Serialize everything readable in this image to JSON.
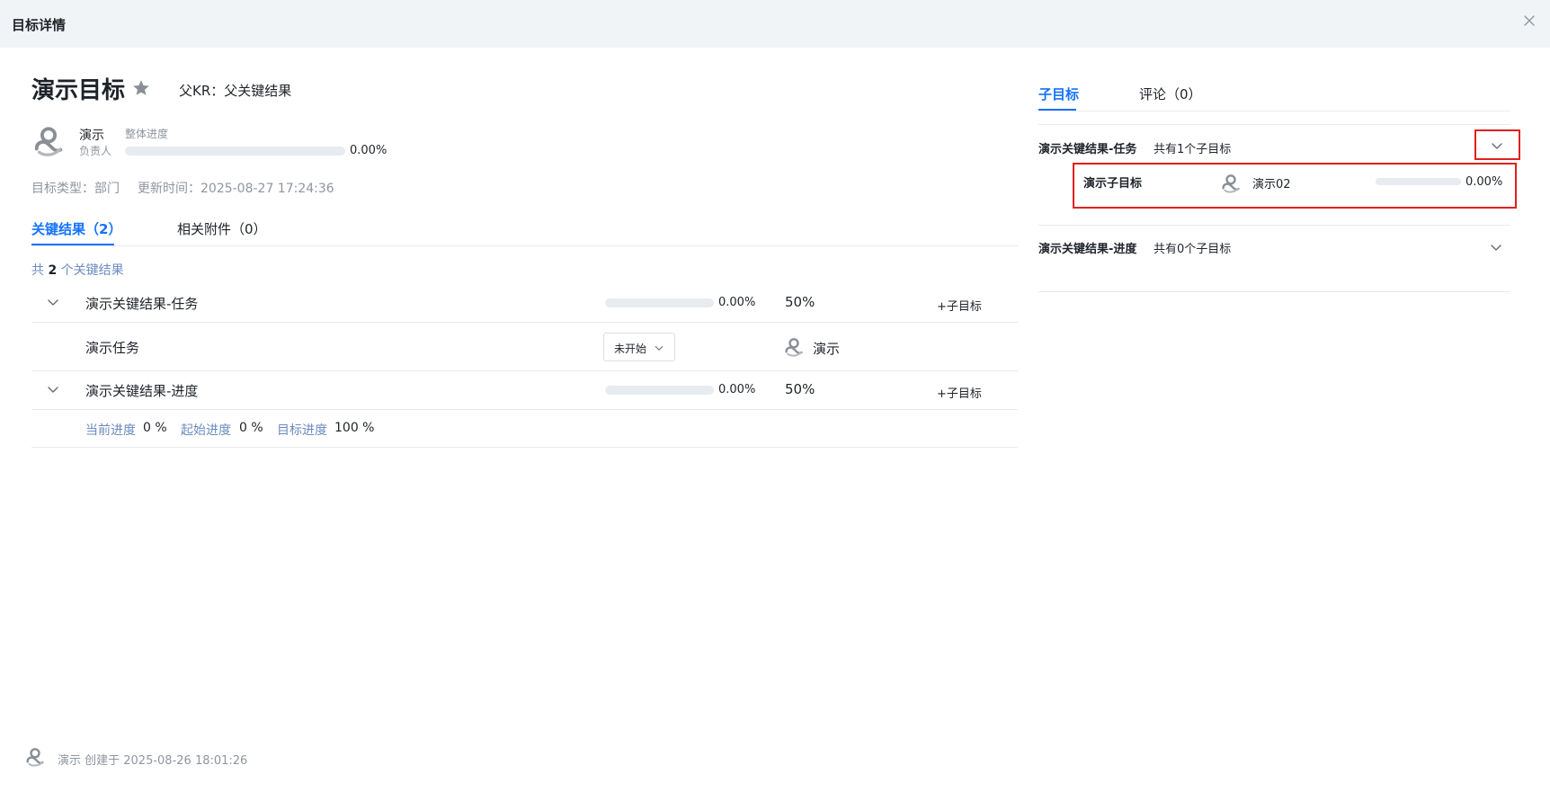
{
  "header": {
    "title": "目标详情"
  },
  "goal": {
    "title": "演示目标",
    "parent_kr": "父KR：父关键结果",
    "owner_name": "演示",
    "owner_role": "负责人",
    "overall_label": "整体进度",
    "overall_progress": 0,
    "overall_progress_text": "0.00%",
    "type_text": "目标类型：部门",
    "updated_text": "更新时间：2025-08-27 17:24:36"
  },
  "left_tabs": [
    {
      "label": "关键结果（2）",
      "active": true
    },
    {
      "label": "相关附件（0）",
      "active": false
    }
  ],
  "kr_summary": {
    "prefix": "共",
    "count": "2",
    "suffix": "个关键结果"
  },
  "key_results": [
    {
      "name": "演示关键结果-任务",
      "progress": 0,
      "progress_text": "0.00%",
      "weight": "50%",
      "add_label": "+子目标"
    },
    {
      "name": "演示关键结果-进度",
      "progress": 0,
      "progress_text": "0.00%",
      "weight": "50%",
      "add_label": "+子目标"
    }
  ],
  "task": {
    "name": "演示任务",
    "status": "未开始",
    "assignee": "演示"
  },
  "progress_detail": {
    "current_label": "当前进度",
    "current_value": "0 %",
    "start_label": "起始进度",
    "start_value": "0 %",
    "target_label": "目标进度",
    "target_value": "100 %"
  },
  "footer": {
    "created_text": "演示 创建于 2025-08-26 18:01:26"
  },
  "right_tabs": [
    {
      "label": "子目标",
      "active": true
    },
    {
      "label": "评论（0）",
      "active": false
    }
  ],
  "sub_groups": [
    {
      "title": "演示关键结果-任务",
      "count_text": "共有1个子目标",
      "expanded": true,
      "items": [
        {
          "name": "演示子目标",
          "owner": "演示02",
          "progress": 0,
          "progress_text": "0.00%"
        }
      ]
    },
    {
      "title": "演示关键结果-进度",
      "count_text": "共有0个子目标",
      "expanded": false,
      "items": []
    }
  ],
  "colors": {
    "accent": "#1672ff",
    "highlight": "#e02020",
    "header_bg": "#f1f4f7"
  },
  "icons": {
    "close": "close-icon",
    "star": "star-icon",
    "chevron": "chevron-down-icon",
    "avatar": "avatar-icon"
  }
}
